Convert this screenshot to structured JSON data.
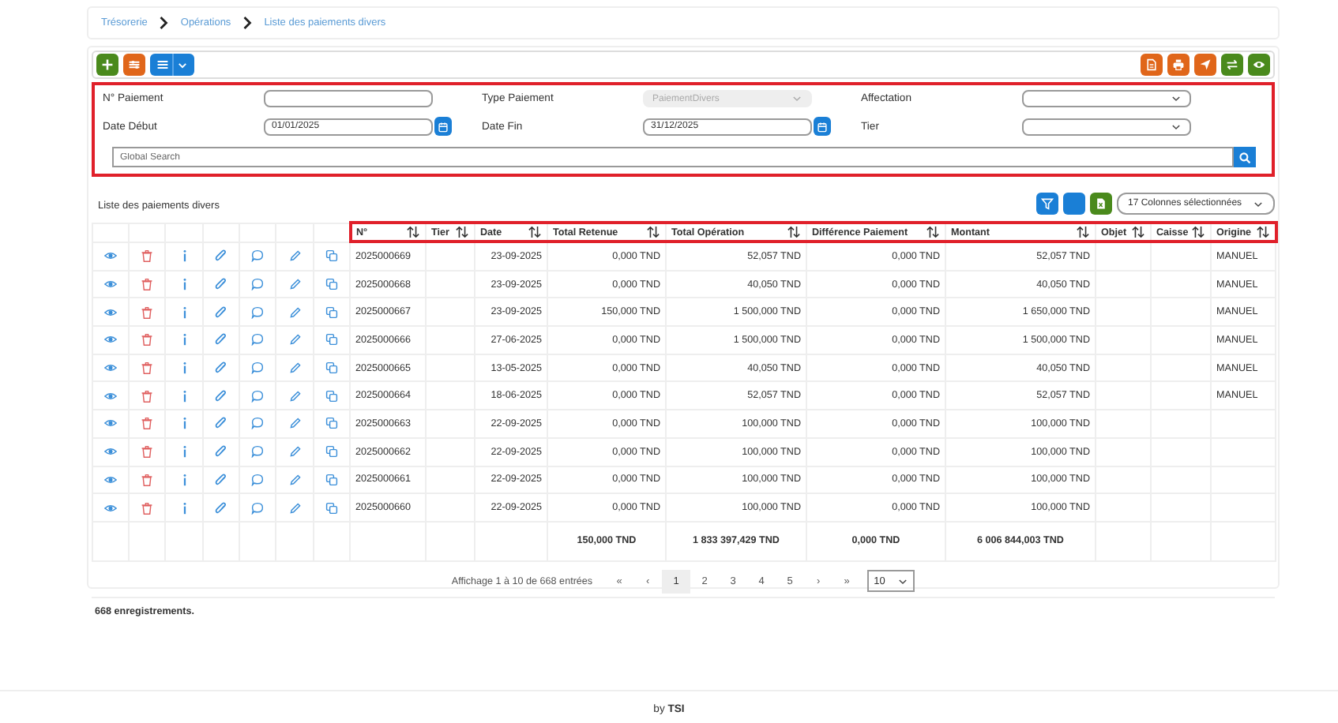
{
  "breadcrumb": [
    {
      "label": "Trésorerie"
    },
    {
      "label": "Opérations"
    },
    {
      "label": "Liste des paiements divers"
    }
  ],
  "filters": [
    {
      "label": "N° Paiement",
      "kind": "text",
      "disabled": false
    },
    {
      "label": "Type Paiement",
      "kind": "select",
      "value": "PaiementDivers",
      "disabled": true
    },
    {
      "label": "Affectation",
      "kind": "select",
      "disabled": false
    },
    {
      "label": "Date Début",
      "kind": "date",
      "value": "01/01/2025",
      "disabled": false
    },
    {
      "label": "Date Fin",
      "kind": "date",
      "value": "31/12/2025",
      "disabled": false
    },
    {
      "label": "Tier",
      "kind": "select",
      "disabled": false
    }
  ],
  "global_search": {
    "placeholder": "Global Search"
  },
  "list": {
    "title": "Liste des paiements divers",
    "column_selector": "17 Colonnes sélectionnées",
    "columns": [
      {
        "label": "N°"
      },
      {
        "label": "Tier"
      },
      {
        "label": "Date"
      },
      {
        "label": "Total Retenue"
      },
      {
        "label": "Total Opération"
      },
      {
        "label": "Différence Paiement"
      },
      {
        "label": "Montant"
      },
      {
        "label": "Objet"
      },
      {
        "label": "Caisse"
      },
      {
        "label": "Origine"
      }
    ],
    "rows": [
      {
        "numero": "2025000669",
        "date": "23-09-2025",
        "total_retenue": "0,000 TND",
        "total_operation": "52,057 TND",
        "difference": "0,000 TND",
        "montant": "52,057 TND",
        "origine": "MANUEL"
      },
      {
        "numero": "2025000668",
        "date": "23-09-2025",
        "total_retenue": "0,000 TND",
        "total_operation": "40,050 TND",
        "difference": "0,000 TND",
        "montant": "40,050 TND",
        "origine": "MANUEL"
      },
      {
        "numero": "2025000667",
        "date": "23-09-2025",
        "total_retenue": "150,000 TND",
        "total_operation": "1 500,000 TND",
        "difference": "0,000 TND",
        "montant": "1 650,000 TND",
        "origine": "MANUEL"
      },
      {
        "numero": "2025000666",
        "date": "27-06-2025",
        "total_retenue": "0,000 TND",
        "total_operation": "1 500,000 TND",
        "difference": "0,000 TND",
        "montant": "1 500,000 TND",
        "origine": "MANUEL"
      },
      {
        "numero": "2025000665",
        "date": "13-05-2025",
        "total_retenue": "0,000 TND",
        "total_operation": "40,050 TND",
        "difference": "0,000 TND",
        "montant": "40,050 TND",
        "origine": "MANUEL"
      },
      {
        "numero": "2025000664",
        "date": "18-06-2025",
        "total_retenue": "0,000 TND",
        "total_operation": "52,057 TND",
        "difference": "0,000 TND",
        "montant": "52,057 TND",
        "origine": "MANUEL"
      },
      {
        "numero": "2025000663",
        "date": "22-09-2025",
        "total_retenue": "0,000 TND",
        "total_operation": "100,000 TND",
        "difference": "0,000 TND",
        "montant": "100,000 TND"
      },
      {
        "numero": "2025000662",
        "date": "22-09-2025",
        "total_retenue": "0,000 TND",
        "total_operation": "100,000 TND",
        "difference": "0,000 TND",
        "montant": "100,000 TND"
      },
      {
        "numero": "2025000661",
        "date": "22-09-2025",
        "total_retenue": "0,000 TND",
        "total_operation": "100,000 TND",
        "difference": "0,000 TND",
        "montant": "100,000 TND"
      },
      {
        "numero": "2025000660",
        "date": "22-09-2025",
        "total_retenue": "0,000 TND",
        "total_operation": "100,000 TND",
        "difference": "0,000 TND",
        "montant": "100,000 TND"
      }
    ],
    "totals": {
      "total_retenue": "150,000 TND",
      "total_operation": "1 833 397,429 TND",
      "difference": "0,000 TND",
      "montant": "6 006 844,003 TND"
    }
  },
  "pagination": {
    "summary": "Affichage 1 à 10 de 668 entrées",
    "items": [
      {
        "label": "«",
        "selected": false
      },
      {
        "label": "‹",
        "selected": false
      },
      {
        "label": "1",
        "selected": true
      },
      {
        "label": "2",
        "selected": false
      },
      {
        "label": "3",
        "selected": false
      },
      {
        "label": "4",
        "selected": false
      },
      {
        "label": "5",
        "selected": false
      },
      {
        "label": "›",
        "selected": false
      },
      {
        "label": "»",
        "selected": false
      }
    ],
    "page_size": "10"
  },
  "record_count": "668 enregistrements.",
  "footer": "by **TSI**"
}
